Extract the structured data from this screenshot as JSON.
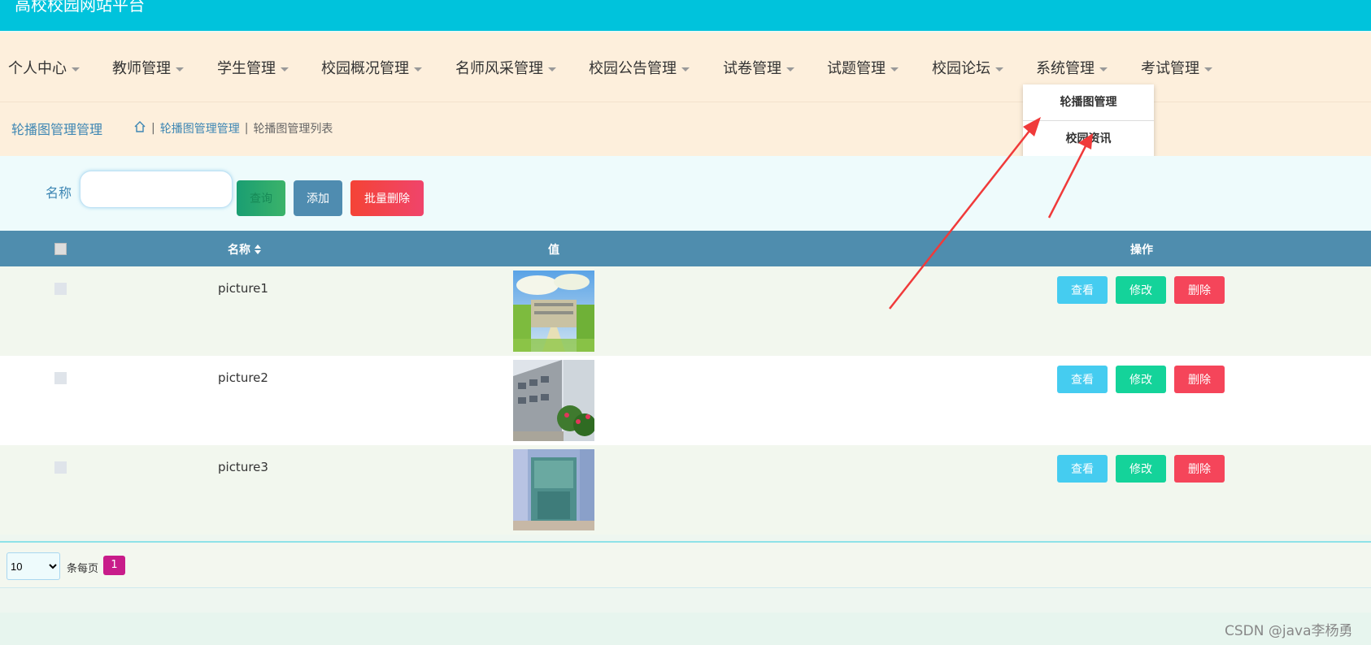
{
  "app": {
    "title": "高校校园网站平台"
  },
  "nav": {
    "items": [
      {
        "label": "个人中心"
      },
      {
        "label": "教师管理"
      },
      {
        "label": "学生管理"
      },
      {
        "label": "校园概况管理"
      },
      {
        "label": "名师风采管理"
      },
      {
        "label": "校园公告管理"
      },
      {
        "label": "试卷管理"
      },
      {
        "label": "试题管理"
      },
      {
        "label": "校园论坛"
      },
      {
        "label": "系统管理"
      },
      {
        "label": "考试管理"
      }
    ],
    "dropdown": {
      "items": [
        {
          "label": "轮播图管理"
        },
        {
          "label": "校园资讯"
        }
      ]
    }
  },
  "page": {
    "title": "轮播图管理管理",
    "breadcrumb": {
      "home_icon": "home-icon",
      "items": [
        "轮播图管理管理",
        "轮播图管理列表"
      ]
    }
  },
  "search": {
    "label": "名称",
    "value": "",
    "search_label": "查询",
    "add_label": "添加",
    "batch_delete_label": "批量删除"
  },
  "table": {
    "headers": {
      "name": "名称",
      "sort_icon": "sort-icon",
      "value": "值",
      "actions": "操作"
    },
    "rows": [
      {
        "name": "picture1"
      },
      {
        "name": "picture2"
      },
      {
        "name": "picture3"
      }
    ],
    "actions": {
      "view": "查看",
      "edit": "修改",
      "delete": "删除"
    }
  },
  "pagination": {
    "page_size": "10",
    "per_page_label": "条每页",
    "current_page": "1"
  },
  "watermark": "CSDN @java李杨勇",
  "colors": {
    "topbar": "#00c3dc",
    "nav_bg": "#fdefdc",
    "table_header": "#4f8dae",
    "active_page": "#c81c8a",
    "arrow": "#f03a3a"
  }
}
